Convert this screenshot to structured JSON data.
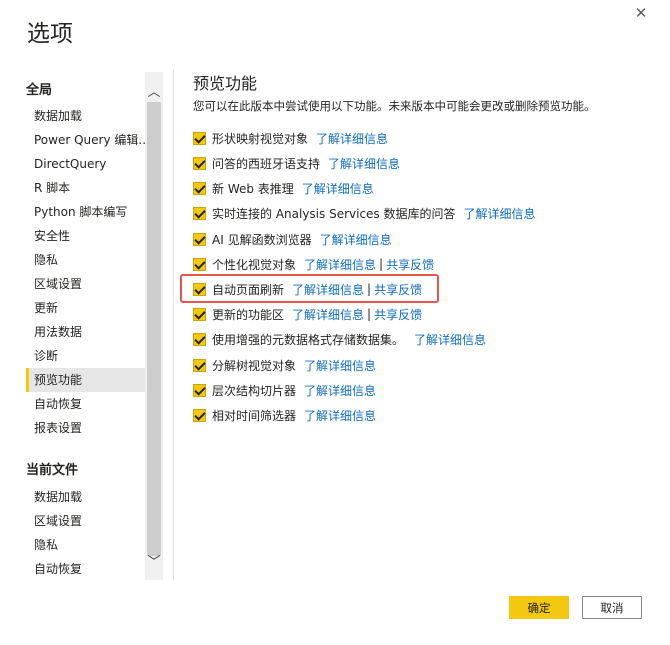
{
  "dialog": {
    "title": "选项",
    "close_icon": "✕"
  },
  "sidebar": {
    "global_title": "全局",
    "global_items": [
      {
        "label": "数据加载"
      },
      {
        "label": "Power Query 编辑..."
      },
      {
        "label": "DirectQuery"
      },
      {
        "label": "R 脚本"
      },
      {
        "label": "Python 脚本编写"
      },
      {
        "label": "安全性"
      },
      {
        "label": "隐私"
      },
      {
        "label": "区域设置"
      },
      {
        "label": "更新"
      },
      {
        "label": "用法数据"
      },
      {
        "label": "诊断"
      },
      {
        "label": "预览功能",
        "selected": true
      },
      {
        "label": "自动恢复"
      },
      {
        "label": "报表设置"
      }
    ],
    "current_title": "当前文件",
    "current_items": [
      {
        "label": "数据加载"
      },
      {
        "label": "区域设置"
      },
      {
        "label": "隐私"
      },
      {
        "label": "自动恢复"
      }
    ],
    "scroll_up_icon": "︿",
    "scroll_down_icon": "﹀"
  },
  "main": {
    "title": "预览功能",
    "description": "您可以在此版本中尝试使用以下功能。未来版本中可能会更改或删除预览功能。",
    "features": [
      {
        "label": "形状映射视觉对象",
        "checked": true,
        "link": "了解详细信息"
      },
      {
        "label": "问答的西班牙语支持",
        "checked": true,
        "link": "了解详细信息"
      },
      {
        "label": "新 Web 表推理",
        "checked": true,
        "link": "了解详细信息"
      },
      {
        "label": "实时连接的 Analysis Services 数据库的问答",
        "checked": true,
        "link": "了解详细信息"
      },
      {
        "label": "AI 见解函数浏览器",
        "checked": true,
        "link": "了解详细信息"
      },
      {
        "label": "个性化视觉对象",
        "checked": true,
        "link": "了解详细信息",
        "separator": "|",
        "link2": "共享反馈"
      },
      {
        "label": "自动页面刷新",
        "checked": true,
        "link": "了解详细信息",
        "separator": "|",
        "link2": "共享反馈"
      },
      {
        "label": "更新的功能区",
        "checked": true,
        "link": "了解详细信息",
        "separator": "|",
        "link2": "共享反馈"
      },
      {
        "label": "使用增强的元数据格式存储数据集。",
        "checked": true,
        "link": "了解详细信息"
      },
      {
        "label": "分解树视觉对象",
        "checked": true,
        "link": "了解详细信息"
      },
      {
        "label": "层次结构切片器",
        "checked": true,
        "link": "了解详细信息"
      },
      {
        "label": "相对时间筛选器",
        "checked": true,
        "link": "了解详细信息"
      }
    ]
  },
  "footer": {
    "ok_label": "确定",
    "cancel_label": "取消"
  },
  "colors": {
    "accent": "#f2c811",
    "link": "#0f6cbd",
    "highlight": "#e8534a"
  }
}
